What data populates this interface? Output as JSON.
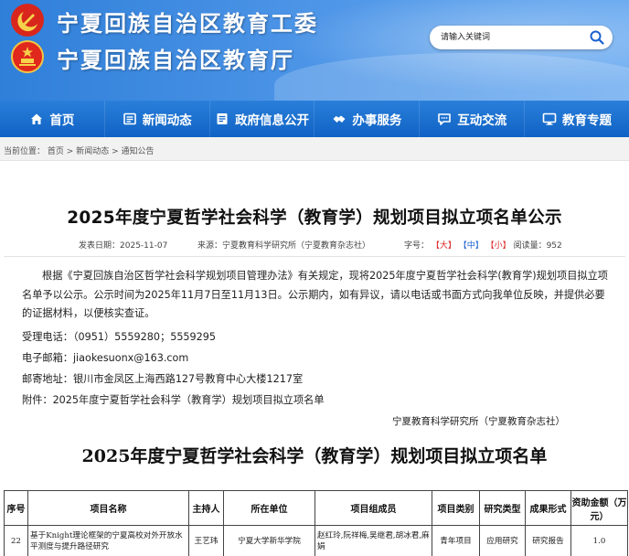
{
  "header": {
    "line1": "宁夏回族自治区教育工委",
    "line2": "宁夏回族自治区教育厅"
  },
  "search": {
    "placeholder": "请输入关键词",
    "icon": "search-icon"
  },
  "nav": {
    "items": [
      {
        "label": "首页",
        "icon": "home-icon"
      },
      {
        "label": "新闻动态",
        "icon": "newspaper-icon"
      },
      {
        "label": "政府信息公开",
        "icon": "document-icon"
      },
      {
        "label": "办事服务",
        "icon": "handshake-icon"
      },
      {
        "label": "互动交流",
        "icon": "chat-icon"
      },
      {
        "label": "教育专题",
        "icon": "monitor-icon"
      }
    ]
  },
  "breadcrumb": {
    "prefix": "当前位置：",
    "items": [
      "首页",
      "新闻动态",
      "通知公告"
    ],
    "sep": ">"
  },
  "article": {
    "title": "2025年度宁夏哲学社会科学（教育学）规划项目拟立项名单公示",
    "meta": {
      "date_label": "发表日期：",
      "date": "2025-11-07",
      "source_label": "来源：",
      "source": "宁夏教育科学研究所（宁夏教育杂志社）",
      "size_label": "字号：",
      "size_large": "【大】",
      "size_medium": "【中】",
      "size_small": "【小】",
      "views_label": "阅读量：",
      "views": "952"
    },
    "paragraph": "根据《宁夏回族自治区哲学社会科学规划项目管理办法》有关规定，现将2025年度宁夏哲学社会科学(教育学)规划项目拟立项名单予以公示。公示时间为2025年11月7日至11月13日。公示期内，如有异议，请以电话或书面方式向我单位反映，并提供必要的证据材料，以便核实查证。",
    "phone": "受理电话：（0951）5559280；5559295",
    "email": "电子邮箱：jiaokesuonx@163.com",
    "address": "邮寄地址：银川市金凤区上海西路127号教育中心大楼1217室",
    "attachment": "附件：2025年度宁夏哲学社会科学（教育学）规划项目拟立项名单",
    "signature": "宁夏教育科学研究所（宁夏教育杂志社）"
  },
  "document": {
    "title": "2025年度宁夏哲学社会科学（教育学）规划项目拟立项名单",
    "columns": [
      "序号",
      "项目名称",
      "主持人",
      "所在单位",
      "项目组成员",
      "项目类别",
      "研究类型",
      "成果形式",
      "资助金额（万元）"
    ],
    "rows": [
      {
        "no": "22",
        "name": "基于Knight理论框架的宁夏高校对外开放水平测度与提升路径研究",
        "host": "王艺玮",
        "unit": "宁夏大学新华学院",
        "members": "赵红玲,阮祥梅,吴继君,胡冰君,麻娟",
        "category": "青年项目",
        "research_type": "应用研究",
        "output": "研究报告",
        "funding": "1.0"
      }
    ]
  },
  "colors": {
    "nav_bg": "#1466c8",
    "header_bg": "#3a88de",
    "title_text": "#111111",
    "size_active": "#1a5fcf",
    "size_link": "#dd2222"
  }
}
